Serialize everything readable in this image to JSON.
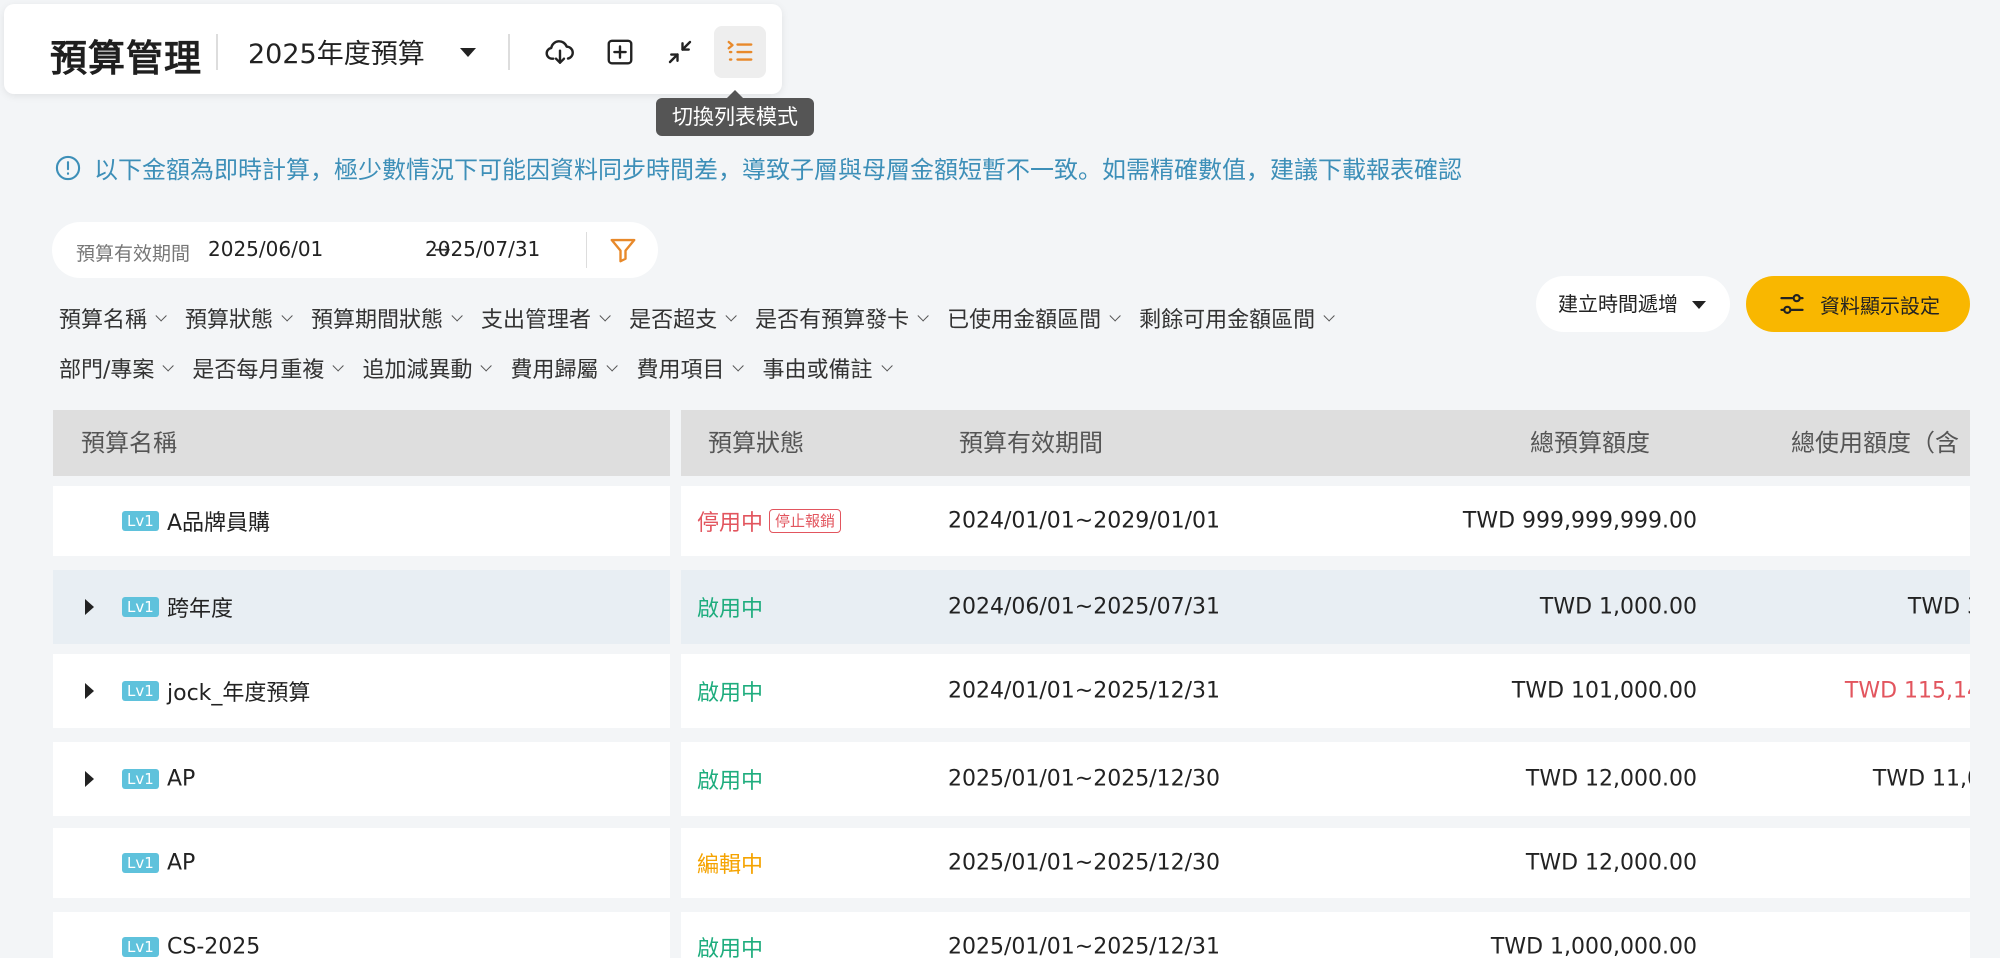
{
  "header": {
    "title": "預算管理",
    "year_select": "2025年度預算",
    "tooltip": "切換列表模式"
  },
  "notice": {
    "text": "以下金額為即時計算，極少數情況下可能因資料同步時間差，導致子層與母層金額短暫不一致。如需精確數值，建議下載報表確認"
  },
  "date_filter": {
    "label": "預算有效期間",
    "start": "2025/06/01",
    "arrow": "→",
    "end": "2025/07/31"
  },
  "filters_row1": [
    "預算名稱",
    "預算狀態",
    "預算期間狀態",
    "支出管理者",
    "是否超支",
    "是否有預算發卡",
    "已使用金額區間",
    "剩餘可用金額區間"
  ],
  "filters_row2": [
    "部門/專案",
    "是否每月重複",
    "追加減異動",
    "費用歸屬",
    "費用項目",
    "事由或備註"
  ],
  "sort": {
    "label": "建立時間遞增"
  },
  "settings_button": {
    "label": "資料顯示設定"
  },
  "table": {
    "columns": [
      "預算名稱",
      "預算狀態",
      "預算有效期間",
      "總預算額度",
      "總使用額度（含"
    ],
    "rows": [
      {
        "level": "Lv1",
        "name": "A品牌員購",
        "expandable": false,
        "status": "停用中",
        "status_color": "#e2555e",
        "badge": "停止報銷",
        "period": "2024/01/01~2029/01/01",
        "total": "TWD 999,999,999.00",
        "used": "",
        "used_color": "#222222"
      },
      {
        "level": "Lv1",
        "name": "跨年度",
        "expandable": true,
        "status": "啟用中",
        "status_color": "#1fad7e",
        "badge": "",
        "period": "2024/06/01~2025/07/31",
        "total": "TWD 1,000.00",
        "used": "TWD 3",
        "used_color": "#222222"
      },
      {
        "level": "Lv1",
        "name": "jock_年度預算",
        "expandable": true,
        "status": "啟用中",
        "status_color": "#1fad7e",
        "badge": "",
        "period": "2024/01/01~2025/12/31",
        "total": "TWD 101,000.00",
        "used": "TWD 115,14",
        "used_color": "#e2555e"
      },
      {
        "level": "Lv1",
        "name": "AP",
        "expandable": true,
        "status": "啟用中",
        "status_color": "#1fad7e",
        "badge": "",
        "period": "2025/01/01~2025/12/30",
        "total": "TWD 12,000.00",
        "used": "TWD 11,0",
        "used_color": "#222222"
      },
      {
        "level": "Lv1",
        "name": "AP",
        "expandable": false,
        "status": "編輯中",
        "status_color": "#f5a300",
        "badge": "",
        "period": "2025/01/01~2025/12/30",
        "total": "TWD 12,000.00",
        "used": "",
        "used_color": "#222222"
      },
      {
        "level": "Lv1",
        "name": "CS-2025",
        "expandable": false,
        "status": "啟用中",
        "status_color": "#1fad7e",
        "badge": "",
        "period": "2025/01/01~2025/12/31",
        "total": "TWD 1,000,000.00",
        "used": "",
        "used_color": "#222222"
      }
    ]
  },
  "colors": {
    "accent": "#f9b700",
    "notice": "#3d8fb8",
    "active_status": "#1fad7e",
    "stopped_status": "#e2555e",
    "editing_status": "#f5a300",
    "level_badge": "#5fc2dc"
  }
}
